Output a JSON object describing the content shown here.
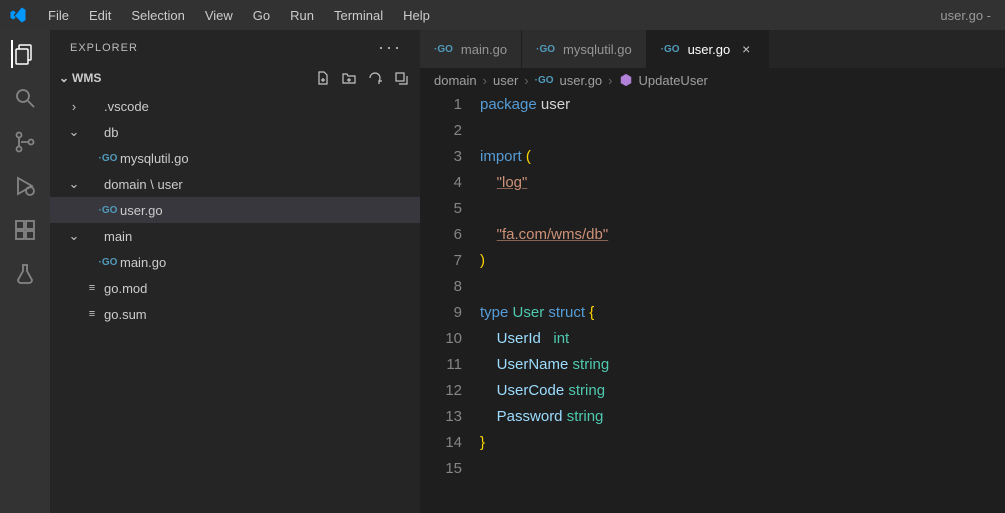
{
  "titlebar": {
    "menus": [
      "File",
      "Edit",
      "Selection",
      "View",
      "Go",
      "Run",
      "Terminal",
      "Help"
    ],
    "title_suffix": "user.go -"
  },
  "sidebar": {
    "title": "EXPLORER",
    "workspace": "WMS",
    "tree": [
      {
        "depth": 0,
        "kind": "folder-collapsed",
        "label": ".vscode"
      },
      {
        "depth": 0,
        "kind": "folder-open",
        "label": "db"
      },
      {
        "depth": 1,
        "kind": "go",
        "label": "mysqlutil.go"
      },
      {
        "depth": 0,
        "kind": "folder-open",
        "label": "domain \\ user"
      },
      {
        "depth": 1,
        "kind": "go",
        "label": "user.go",
        "selected": true
      },
      {
        "depth": 0,
        "kind": "folder-open",
        "label": "main"
      },
      {
        "depth": 1,
        "kind": "go",
        "label": "main.go"
      },
      {
        "depth": 0,
        "kind": "file",
        "label": "go.mod"
      },
      {
        "depth": 0,
        "kind": "file",
        "label": "go.sum"
      }
    ]
  },
  "tabs": [
    {
      "icon": "go",
      "label": "main.go",
      "active": false
    },
    {
      "icon": "go",
      "label": "mysqlutil.go",
      "active": false
    },
    {
      "icon": "go",
      "label": "user.go",
      "active": true,
      "closable": true
    }
  ],
  "breadcrumb": {
    "parts": [
      "domain",
      "user"
    ],
    "file_icon": "go",
    "file": "user.go",
    "symbol_icon": "method",
    "symbol": "UpdateUser"
  },
  "code": {
    "lines": [
      {
        "n": 1,
        "tokens": [
          {
            "t": "package ",
            "c": "kw"
          },
          {
            "t": "user",
            "c": "plain"
          }
        ]
      },
      {
        "n": 2,
        "tokens": []
      },
      {
        "n": 3,
        "tokens": [
          {
            "t": "import ",
            "c": "kw"
          },
          {
            "t": "(",
            "c": "brace"
          }
        ]
      },
      {
        "n": 4,
        "tokens": [
          {
            "t": "    ",
            "c": "plain"
          },
          {
            "t": "\"log\"",
            "c": "str"
          }
        ]
      },
      {
        "n": 5,
        "tokens": []
      },
      {
        "n": 6,
        "tokens": [
          {
            "t": "    ",
            "c": "plain"
          },
          {
            "t": "\"fa.com/wms/db\"",
            "c": "str"
          }
        ]
      },
      {
        "n": 7,
        "tokens": [
          {
            "t": ")",
            "c": "brace"
          }
        ]
      },
      {
        "n": 8,
        "tokens": []
      },
      {
        "n": 9,
        "tokens": [
          {
            "t": "type ",
            "c": "kw"
          },
          {
            "t": "User ",
            "c": "type"
          },
          {
            "t": "struct ",
            "c": "kw"
          },
          {
            "t": "{",
            "c": "brace"
          }
        ]
      },
      {
        "n": 10,
        "tokens": [
          {
            "t": "    UserId   ",
            "c": "id"
          },
          {
            "t": "int",
            "c": "type"
          }
        ]
      },
      {
        "n": 11,
        "tokens": [
          {
            "t": "    UserName ",
            "c": "id"
          },
          {
            "t": "string",
            "c": "type"
          }
        ]
      },
      {
        "n": 12,
        "tokens": [
          {
            "t": "    UserCode ",
            "c": "id"
          },
          {
            "t": "string",
            "c": "type"
          }
        ]
      },
      {
        "n": 13,
        "tokens": [
          {
            "t": "    Password ",
            "c": "id"
          },
          {
            "t": "string",
            "c": "type"
          }
        ]
      },
      {
        "n": 14,
        "tokens": [
          {
            "t": "}",
            "c": "brace"
          }
        ]
      },
      {
        "n": 15,
        "tokens": []
      }
    ]
  }
}
